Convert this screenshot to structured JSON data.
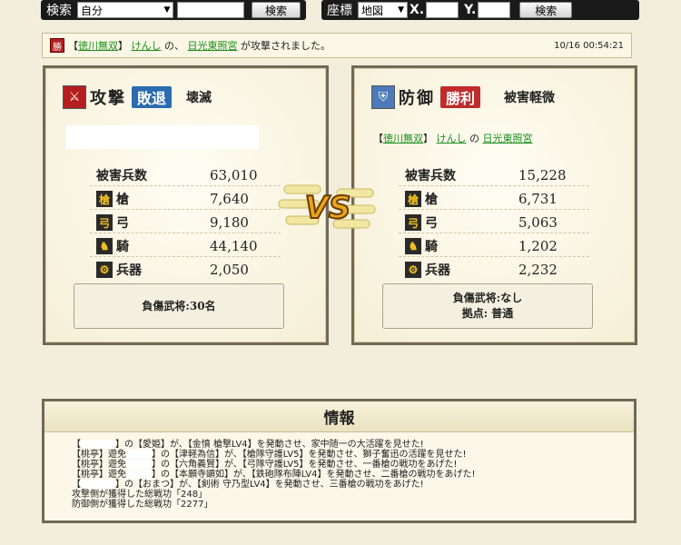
{
  "search": {
    "label": "検索",
    "select_value": "自分",
    "input_value": "",
    "button_label": "検索"
  },
  "coord": {
    "label": "座標",
    "select_value": "地図",
    "x_label": "X.",
    "y_label": "Y.",
    "x_value": "",
    "y_value": "",
    "button_label": "検索"
  },
  "notice": {
    "badge": "勝",
    "bracket_open": "【",
    "alliance": "徳川無双",
    "bracket_close": "】",
    "player": "けんし",
    "mid_text": "の、",
    "location": "日光東照宮",
    "end_text": "が攻撃されました。",
    "timestamp": "10/16 00:54:21"
  },
  "attack": {
    "role_icon": "crossed-swords-icon",
    "role_label": "攻撃",
    "result": "敗退",
    "damage_status": "壊滅",
    "name": "",
    "stats": {
      "total_label": "被害兵数",
      "total_value": "63,010",
      "spear_label": "槍",
      "spear_value": "7,640",
      "bow_label": "弓",
      "bow_value": "9,180",
      "cav_label": "騎",
      "cav_value": "44,140",
      "weapon_label": "兵器",
      "weapon_value": "2,050"
    },
    "footer_line1": "負傷武将:30名"
  },
  "defense": {
    "role_icon": "shield-icon",
    "role_label": "防御",
    "result": "勝利",
    "damage_status": "被害軽微",
    "bracket_open": "【",
    "alliance": "徳川無双",
    "bracket_close": "】",
    "player": "けんし",
    "of": "の",
    "location": "日光東照宮",
    "stats": {
      "total_label": "被害兵数",
      "total_value": "15,228",
      "spear_label": "槍",
      "spear_value": "6,731",
      "bow_label": "弓",
      "bow_value": "5,063",
      "cav_label": "騎",
      "cav_value": "1,202",
      "weapon_label": "兵器",
      "weapon_value": "2,232"
    },
    "footer_line1": "負傷武将:なし",
    "footer_line2": "拠点: 普通"
  },
  "vs_label": "VS",
  "info": {
    "title": "情報",
    "lines": [
      {
        "pre": "【",
        "post": "】の【愛姫】が、【金憤 槍撃LV4】を発動させ、家中随一の大活躍を見せた!"
      },
      {
        "pre": "【桃亭】遊免",
        "post": "】の【津軽為信】が、【槍隊守護LV5】を発動させ、獅子奮迅の活躍を見せた!"
      },
      {
        "pre": "【桃亭】遊免",
        "post": "】の【六角義賢】が、【弓隊守護LV5】を発動させ、一番槍の戦功をあげた!"
      },
      {
        "pre": "【桃亭】遊免",
        "post": "】の【本願寺顕如】が、【鉄砲隊布陣LV4】を発動させ、二番槍の戦功をあげた!"
      },
      {
        "pre": "【",
        "post": "】の【おまつ】が、【剣術 守乃型LV4】を発動させ、三番槍の戦功をあげた!"
      }
    ],
    "summary_attack": "攻撃側が獲得した総戦功「248」",
    "summary_defense": "防御側が獲得した総戦功「2277」"
  }
}
